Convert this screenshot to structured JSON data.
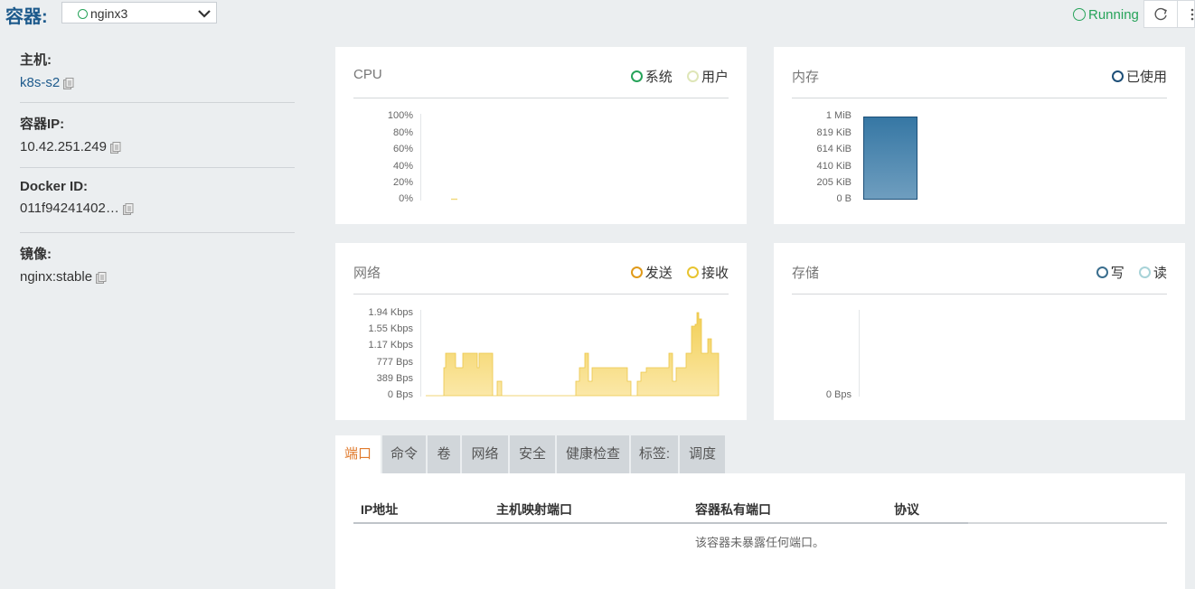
{
  "header": {
    "title": "容器:",
    "container_name": "nginx3",
    "status": "Running"
  },
  "info": {
    "host_label": "主机:",
    "host_value": "k8s-s2",
    "ip_label": "容器IP:",
    "ip_value": "10.42.251.249",
    "docker_label": "Docker ID:",
    "docker_value": "011f94241402…",
    "image_label": "镜像:",
    "image_value": "nginx:stable"
  },
  "cpu": {
    "title": "CPU",
    "legend": [
      "系统",
      "用户"
    ],
    "yticks": [
      "100%",
      "80%",
      "60%",
      "40%",
      "20%",
      "0%"
    ]
  },
  "memory": {
    "title": "内存",
    "legend": [
      "已使用"
    ],
    "yticks": [
      "1 MiB",
      "819 KiB",
      "614 KiB",
      "410 KiB",
      "205 KiB",
      "0 B"
    ]
  },
  "network": {
    "title": "网络",
    "legend": [
      "发送",
      "接收"
    ],
    "yticks": [
      "1.94 Kbps",
      "1.55 Kbps",
      "1.17 Kbps",
      "777 Bps",
      "389 Bps",
      "0 Bps"
    ]
  },
  "storage": {
    "title": "存储",
    "legend": [
      "写",
      "读"
    ],
    "yticks": [
      "0 Bps"
    ]
  },
  "tabs": [
    "端口",
    "命令",
    "卷",
    "网络",
    "安全",
    "健康检查",
    "标签:",
    "调度"
  ],
  "ports": {
    "columns": [
      "IP地址",
      "主机映射端口",
      "容器私有端口",
      "协议"
    ],
    "empty": "该容器未暴露任何端口。"
  },
  "colors": {
    "accent": "#1d5a8c",
    "running": "#27a35a",
    "network_fill": "#f5d66a",
    "memory_bar": "#3f7fab",
    "active_tab": "#e07a2c"
  }
}
